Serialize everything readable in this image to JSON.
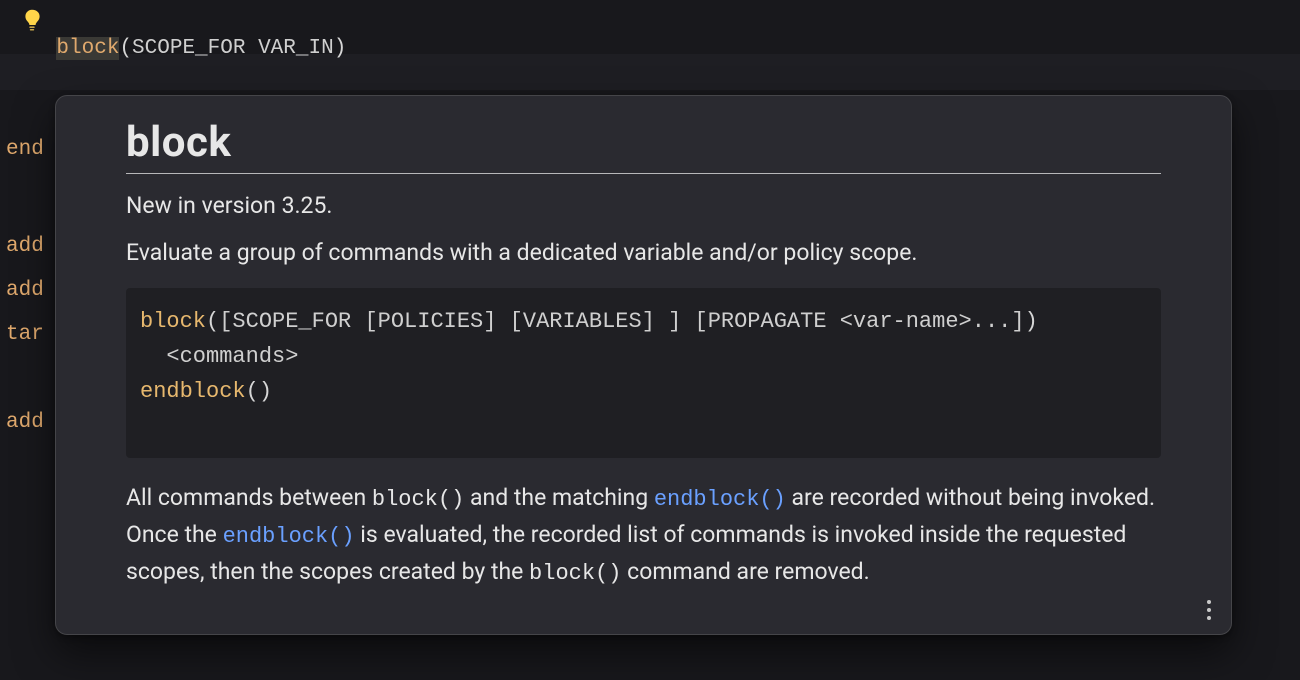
{
  "editor": {
    "signature": {
      "func": "block",
      "open": "(",
      "arg1": "SCOPE_FOR",
      "arg2": "VAR_IN",
      "close": ")"
    },
    "bg_lines": {
      "l1": "end",
      "l2": "add",
      "l3": "add",
      "l4": "tar",
      "l5": "add"
    }
  },
  "popup": {
    "title": "block",
    "version_line": "New in version 3.25.",
    "summary": "Evaluate a group of commands with a dedicated variable and/or policy scope.",
    "codeblock": {
      "l1_func": "block",
      "l1_open": "(",
      "l1_args": "[SCOPE_FOR [POLICIES] [VARIABLES] ] [PROPAGATE <var-name>...]",
      "l1_close": ")",
      "l2": "  <commands>",
      "l3_func": "endblock",
      "l3_parens": "()"
    },
    "body": {
      "t1": "All commands between ",
      "c1": "block()",
      "t2": " and the matching ",
      "link1": "endblock()",
      "t3": " are recorded without being invoked. Once the ",
      "link2": "endblock()",
      "t4": " is evaluated, the recorded list of commands is invoked inside the requested scopes, then the scopes created by the ",
      "c2": "block()",
      "t5": " command are removed."
    }
  },
  "icons": {
    "bulb": "lightbulb-icon",
    "kebab": "more-vertical-icon"
  }
}
